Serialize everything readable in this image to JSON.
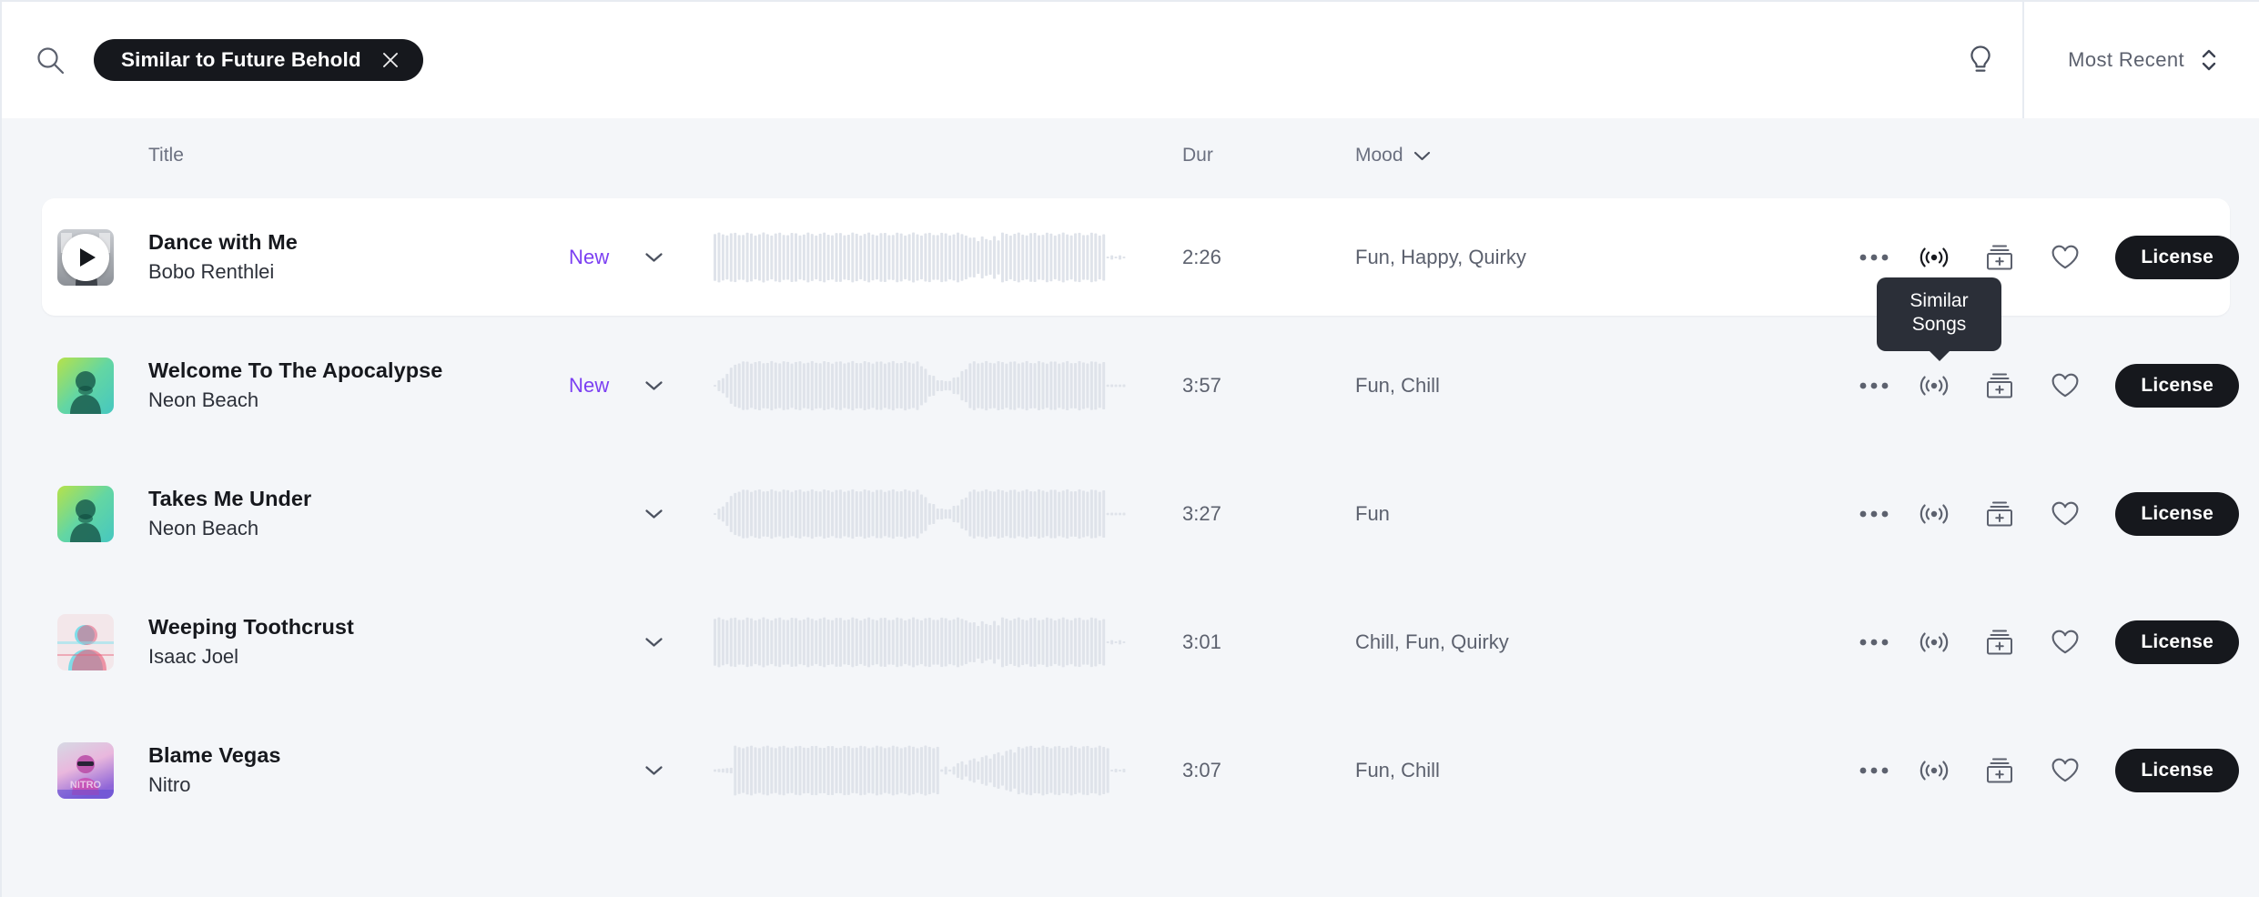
{
  "header": {
    "search_icon": "search-icon",
    "chip": {
      "label": "Similar to Future Behold",
      "close_icon": "close-icon"
    },
    "idea_icon": "lightbulb-icon",
    "sort": {
      "label": "Most Recent",
      "icon": "sort-updown-icon"
    }
  },
  "columns": {
    "title": "Title",
    "duration": "Dur",
    "mood": "Mood",
    "mood_caret": "chevron-down-icon"
  },
  "tooltip": {
    "line1": "Similar",
    "line2": "Songs"
  },
  "actions": {
    "more_icon": "ellipsis-icon",
    "similar_icon": "similar-songs-icon",
    "add_icon": "add-to-playlist-icon",
    "favorite_icon": "heart-icon",
    "license_label": "License"
  },
  "colors": {
    "accent_new": "#7b3ff2",
    "button_dark": "#16181d",
    "page_bg": "#f4f6f9",
    "row_active_bg": "#ffffff",
    "muted_text": "#5c616e",
    "waveform": "#dfe3ea"
  },
  "rows": [
    {
      "title": "Dance with Me",
      "artist": "Bobo Renthlei",
      "badge": "New",
      "duration": "2:26",
      "mood": "Fun, Happy, Quirky",
      "active": true,
      "playing": true,
      "art": "photo-man-grayscale",
      "wave": "dense-flat",
      "tooltip_open": true
    },
    {
      "title": "Welcome To The Apocalypse",
      "artist": "Neon Beach",
      "badge": "New",
      "duration": "3:57",
      "mood": "Fun, Chill",
      "active": false,
      "playing": false,
      "art": "duotone-green-portrait",
      "wave": "mid-dip",
      "tooltip_open": false
    },
    {
      "title": "Takes Me Under",
      "artist": "Neon Beach",
      "badge": "",
      "duration": "3:27",
      "mood": "Fun",
      "active": false,
      "playing": false,
      "art": "duotone-green-portrait",
      "wave": "mid-dip",
      "tooltip_open": false
    },
    {
      "title": "Weeping Toothcrust",
      "artist": "Isaac Joel",
      "badge": "",
      "duration": "3:01",
      "mood": "Chill, Fun, Quirky",
      "active": false,
      "playing": false,
      "art": "glitch-pink-cyan-portrait",
      "wave": "dense-flat",
      "tooltip_open": false
    },
    {
      "title": "Blame Vegas",
      "artist": "Nitro",
      "badge": "",
      "duration": "3:07",
      "mood": "Fun, Chill",
      "active": false,
      "playing": false,
      "art": "magenta-nitro-portrait",
      "wave": "ramp-dip",
      "tooltip_open": false
    }
  ]
}
